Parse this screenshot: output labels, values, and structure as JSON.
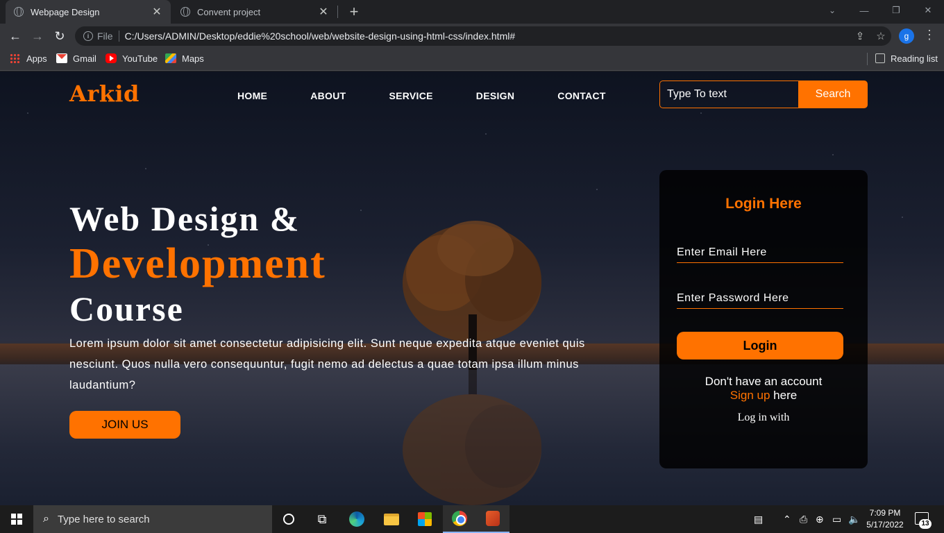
{
  "browser": {
    "tabs": [
      {
        "title": "Webpage Design",
        "active": true
      },
      {
        "title": "Convent project",
        "active": false
      }
    ],
    "address": {
      "scheme": "File",
      "url": "C:/Users/ADMIN/Desktop/eddie%20school/web/website-design-using-html-css/index.html#"
    },
    "profile_initial": "g",
    "bookmarks": [
      "Apps",
      "Gmail",
      "YouTube",
      "Maps"
    ],
    "reading_list": "Reading list"
  },
  "site": {
    "logo": "Arkid",
    "nav": [
      "HOME",
      "ABOUT",
      "SERVICE",
      "DESIGN",
      "CONTACT"
    ],
    "search": {
      "placeholder": "Type To text",
      "button": "Search"
    },
    "hero": {
      "line1": "Web Design &",
      "line2": "Development",
      "line3": "Course",
      "paragraph": "Lorem ipsum dolor sit amet consectetur adipisicing elit. Sunt neque expedita atque eveniet quis nesciunt. Quos nulla vero consequuntur, fugit nemo ad delectus a quae totam ipsa illum minus laudantium?",
      "cta": "JOIN US"
    },
    "login": {
      "title": "Login Here",
      "email_placeholder": "Enter Email Here",
      "password_placeholder": "Enter Password Here",
      "button": "Login",
      "no_account": "Don't have an account",
      "signup": "Sign up",
      "here": " here",
      "log_in_with": "Log in with"
    },
    "colors": {
      "accent": "#ff7200"
    }
  },
  "taskbar": {
    "search_placeholder": "Type here to search",
    "time": "7:09 PM",
    "date": "5/17/2022",
    "notification_count": "13"
  }
}
